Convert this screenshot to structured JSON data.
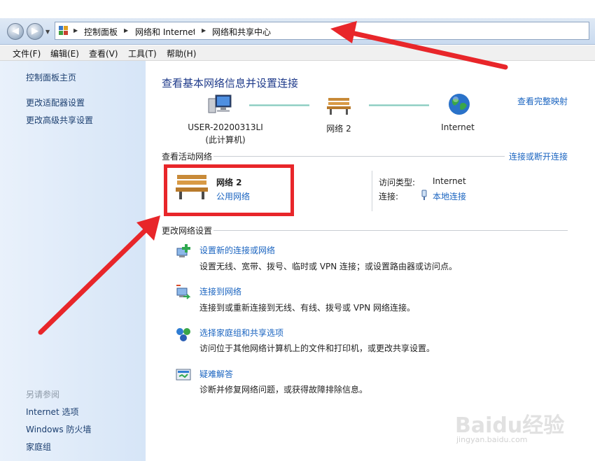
{
  "breadcrumb": [
    "控制面板",
    "网络和 Internet",
    "网络和共享中心"
  ],
  "menu": [
    "文件(F)",
    "编辑(E)",
    "查看(V)",
    "工具(T)",
    "帮助(H)"
  ],
  "sidebar": {
    "home": "控制面板主页",
    "links": [
      "更改适配器设置",
      "更改高级共享设置"
    ],
    "see_also_title": "另请参阅",
    "see_also": [
      "Internet 选项",
      "Windows 防火墙",
      "家庭组"
    ]
  },
  "main": {
    "title": "查看基本网络信息并设置连接",
    "view_full_map": "查看完整映射",
    "nodes": {
      "computer_line1": "USER-20200313LI",
      "computer_line2": "(此计算机)",
      "network": "网络  2",
      "internet": "Internet"
    },
    "active_section": "查看活动网络",
    "connect_disconnect": "连接或断开连接",
    "network_name": "网络  2",
    "network_type": "公用网络",
    "access_type_label": "访问类型:",
    "access_type_value": "Internet",
    "connection_label": "连接:",
    "connection_value": "本地连接",
    "change_section": "更改网络设置",
    "tasks": [
      {
        "title": "设置新的连接或网络",
        "desc": "设置无线、宽带、拨号、临时或 VPN 连接；或设置路由器或访问点。",
        "icon": "new-connection-icon"
      },
      {
        "title": "连接到网络",
        "desc": "连接到或重新连接到无线、有线、拨号或 VPN 网络连接。",
        "icon": "connect-network-icon"
      },
      {
        "title": "选择家庭组和共享选项",
        "desc": "访问位于其他网络计算机上的文件和打印机，或更改共享设置。",
        "icon": "homegroup-icon"
      },
      {
        "title": "疑难解答",
        "desc": "诊断并修复网络问题，或获得故障排除信息。",
        "icon": "troubleshoot-icon"
      }
    ]
  },
  "watermark": {
    "text": "Baidu经验",
    "sub": "jingyan.baidu.com"
  },
  "colors": {
    "annotation_red": "#e8262a",
    "link_blue": "#1a64c0",
    "title_blue": "#1e3a8a",
    "sidebar_bg": "#dde9f8"
  }
}
